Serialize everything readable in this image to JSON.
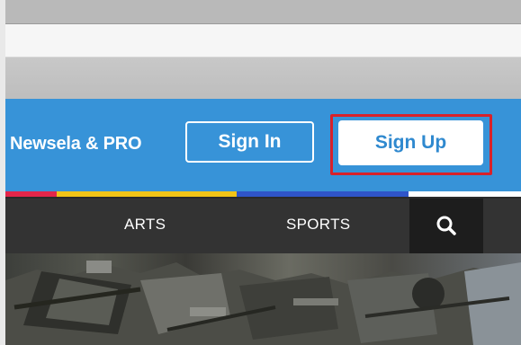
{
  "header": {
    "brand_label": "Newsela & PRO",
    "signin_label": "Sign In",
    "signup_label": "Sign Up",
    "background_color": "#3793d8"
  },
  "color_bar": [
    "#e3264a",
    "#f2c417",
    "#2f55c9"
  ],
  "nav": {
    "items": [
      {
        "label": "ARTS"
      },
      {
        "label": "SPORTS"
      }
    ],
    "search_icon": "search-icon",
    "background_color": "#333333"
  },
  "highlight_color": "#d8212a"
}
